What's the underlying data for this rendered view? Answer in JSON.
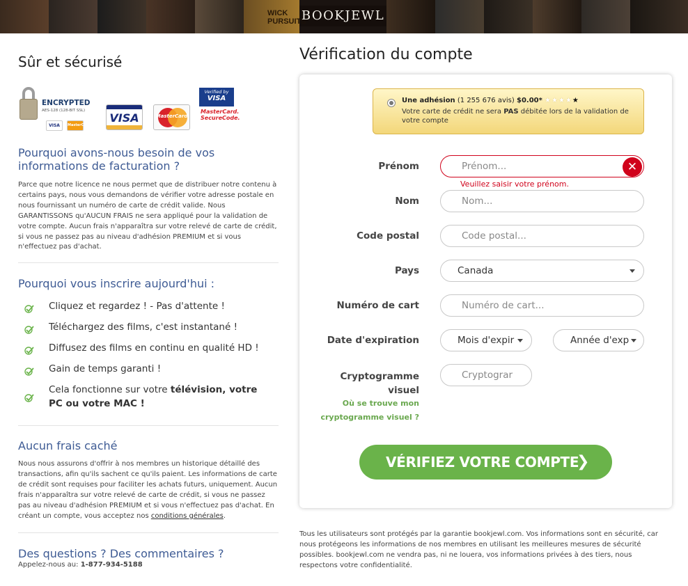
{
  "banner": {
    "logo": "BOOKJEWL",
    "poster_words": [
      "WICK",
      "PURSUITS"
    ]
  },
  "left": {
    "secure_title": "Sûr et sécurisé",
    "badges": {
      "encrypted": "ENCRYPTED",
      "encrypted_sub": "AES-128 (128-BIT SSL)",
      "visa": "VISA",
      "mastercard": "MasterCard",
      "verified_visa_top": "Verified by",
      "verified_visa_brand": "VISA",
      "mc_secure_1": "MasterCard.",
      "mc_secure_2": "SecureCode."
    },
    "why_billing_title": "Pourquoi avons-nous besoin de vos informations de facturation ?",
    "why_billing_text": "Parce que notre licence ne nous permet que de distribuer notre contenu à certains pays, nous vous demandons de vérifier votre adresse postale en nous fournissant un numéro de carte de crédit valide. Nous GARANTISSONS qu'AUCUN FRAIS ne sera appliqué pour la validation de votre compte. Aucun frais n'apparaîtra sur votre relevé de carte de crédit, si vous ne passez pas au niveau d'adhésion PREMIUM et si vous n'effectuez pas d'achat.",
    "why_join_title": "Pourquoi vous inscrire aujourd'hui :",
    "benefits": [
      "Cliquez et regardez ! - Pas d'attente !",
      "Téléchargez des films, c'est instantané !",
      "Diffusez des films en continu en qualité HD !",
      "Gain de temps garanti !"
    ],
    "benefit_last_prefix": "Cela fonctionne sur votre ",
    "benefit_last_bold": "télévision, votre PC ou votre MAC !",
    "no_fees_title": "Aucun frais caché",
    "no_fees_text": "Nous nous assurons d'offrir à nos membres un historique détaillé des transactions, afin qu'ils sachent ce qu'ils paient. Les informations de carte de crédit sont requises pour faciliter les achats futurs, uniquement. Aucun frais n'apparaîtra sur votre relevé de carte de crédit, si vous ne passez pas au niveau d'adhésion PREMIUM et si vous n'effectuez pas d'achat. En créant un compte, vous acceptez nos ",
    "terms_link": "conditions générales",
    "questions_title": "Des questions ? Des commentaires ?",
    "call_label": "Appelez-nous au: ",
    "phone": "1-877-934-5188"
  },
  "form": {
    "title": "Vérification du compte",
    "offer": {
      "name": "Une adhésion",
      "reviews": "(1 255 676 avis)",
      "price": "$0.00*",
      "stars": "★★★★",
      "star_last": "★",
      "note_prefix": "Votre carte de crédit ne sera ",
      "note_bold": "PAS",
      "note_suffix": " débitée lors de la validation de votre compte"
    },
    "labels": {
      "first_name": "Prénom",
      "last_name": "Nom",
      "postal": "Code postal",
      "country": "Pays",
      "card_number": "Numéro de cart",
      "expiry": "Date d'expiration",
      "cvv_1": "Cryptogramme",
      "cvv_2": "visuel"
    },
    "placeholders": {
      "first_name": "Prénom...",
      "last_name": "Nom...",
      "postal": "Code postal...",
      "card_number": "Numéro de cart...",
      "cvv": "Cryptograr"
    },
    "country_value": "Canada",
    "expiry_month": "Mois d'expir",
    "expiry_year": "Année d'exp",
    "first_name_error": "Veuillez saisir votre prénom.",
    "cvv_help_1": "Où se trouve mon",
    "cvv_help_2": "cryptogramme visuel ?",
    "submit": "VÉRIFIEZ VOTRE COMPTE",
    "submit_icon": "chevron-right-icon"
  },
  "footer_text": "Tous les utilisateurs sont protégés par la garantie bookjewl.com. Vos informations sont en sécurité, car nous protégeons les informations de nos membres en utilisant les meilleures mesures de sécurité possibles. bookjewl.com ne vendra pas, ni ne louera, vos informations privées à des tiers, nous respectons votre confidentialité.",
  "colors": {
    "accent_blue": "#3e5b94",
    "cta_green": "#6ab34a",
    "error_red": "#d0021b",
    "check_green": "#6ab34a"
  }
}
